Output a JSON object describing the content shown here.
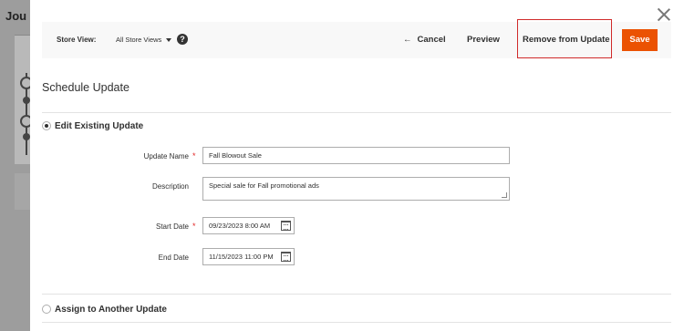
{
  "background": {
    "title": "Jou"
  },
  "toolbar": {
    "store_view_label": "Store View:",
    "store_view_value": "All Store Views",
    "help_glyph": "?",
    "back_glyph": "←",
    "cancel_label": "Cancel",
    "preview_label": "Preview",
    "remove_label": "Remove from Update",
    "save_label": "Save"
  },
  "section": {
    "title": "Schedule Update"
  },
  "options": {
    "edit_existing": "Edit Existing Update",
    "assign_another": "Assign to Another Update",
    "selected": "edit_existing"
  },
  "form": {
    "update_name": {
      "label": "Update Name",
      "value": "Fall Blowout Sale",
      "required": "*"
    },
    "description": {
      "label": "Description",
      "value": "Special sale for Fall promotional ads"
    },
    "start_date": {
      "label": "Start Date",
      "value": "09/23/2023 8:00 AM",
      "required": "*"
    },
    "end_date": {
      "label": "End Date",
      "value": "11/15/2023 11:00 PM"
    }
  },
  "colors": {
    "save_bg": "#eb5202",
    "highlight": "#d02a2a",
    "required": "#e22626"
  }
}
